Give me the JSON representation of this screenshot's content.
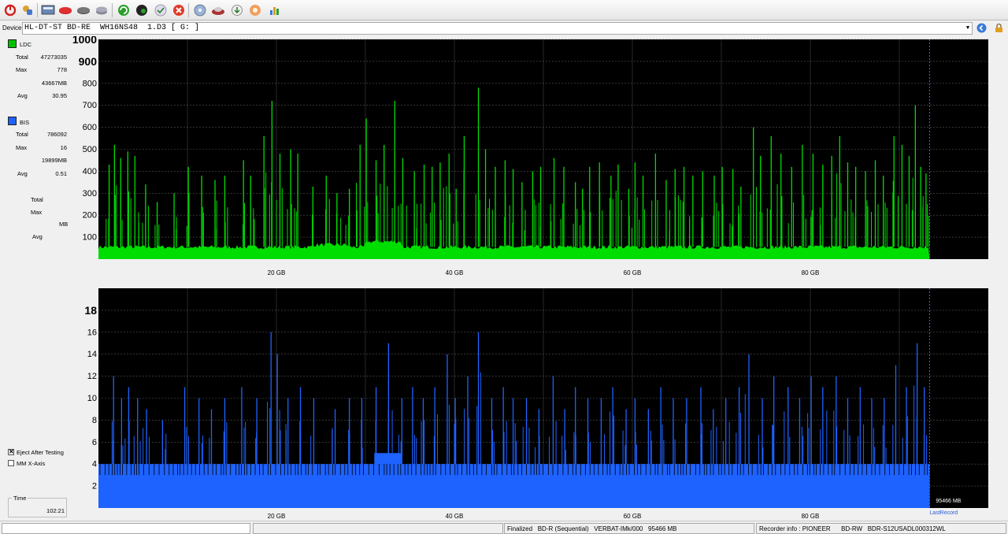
{
  "toolbar": {
    "icons": [
      "power-icon",
      "settings-icon",
      "info-icon",
      "disc-red-icon",
      "disc-erase-icon",
      "disc-copy-icon",
      "refresh-icon",
      "globe-icon",
      "check-icon",
      "stop-icon",
      "disc-blank-icon",
      "burn-icon",
      "save-icon",
      "test-icon",
      "chart-icon"
    ]
  },
  "device": {
    "label": "Device:",
    "value": "HL-DT-ST BD-RE  WH16NS48  1.D3 [ G: ]"
  },
  "stats": {
    "ldc": {
      "name": "LDC",
      "color": "#00cc00",
      "total_label": "Total",
      "total": "47273035",
      "max_label": "Max",
      "max": "778",
      "mb": "43667MB",
      "avg_label": "Avg",
      "avg": "30.95"
    },
    "bis": {
      "name": "BIS",
      "color": "#1e62ff",
      "total_label": "Total",
      "total": "786092",
      "max_label": "Max",
      "max": "16",
      "mb": "19899MB",
      "avg_label": "Avg",
      "avg": "0.51"
    },
    "third": {
      "total_label": "Total",
      "max_label": "Max",
      "mb_label": "MB",
      "avg_label": "Avg"
    }
  },
  "options": {
    "eject_label": "Eject After Testing",
    "eject_checked": true,
    "mm_label": "MM X-Axis",
    "mm_checked": false
  },
  "time": {
    "label": "Time",
    "value": "102:21"
  },
  "chart_data": [
    {
      "type": "bar",
      "series_name": "LDC",
      "color": "#00dd00",
      "xlabels": [
        "20 GB",
        "40 GB",
        "60 GB",
        "80 GB"
      ],
      "xticks_gb": [
        20,
        40,
        60,
        80
      ],
      "xlim_gb": [
        0,
        100
      ],
      "ylim": [
        0,
        1000
      ],
      "ytick_labels": [
        "100",
        "200",
        "300",
        "400",
        "500",
        "600",
        "700",
        "800",
        "900",
        "1000"
      ],
      "data_end_gb": 93.4,
      "baseline": 55,
      "max": 778,
      "peaks": [
        [
          1.2,
          430
        ],
        [
          1.8,
          520
        ],
        [
          2.5,
          460
        ],
        [
          3.3,
          490
        ],
        [
          4.1,
          470
        ],
        [
          5.3,
          340
        ],
        [
          6.6,
          260
        ],
        [
          8.5,
          300
        ],
        [
          10.1,
          420
        ],
        [
          11.6,
          380
        ],
        [
          13.1,
          360
        ],
        [
          14.2,
          380
        ],
        [
          16.3,
          450
        ],
        [
          17.1,
          380
        ],
        [
          18.6,
          560
        ],
        [
          19.5,
          720
        ],
        [
          20.4,
          480
        ],
        [
          21.6,
          500
        ],
        [
          22.4,
          480
        ],
        [
          24.1,
          330
        ],
        [
          25.6,
          380
        ],
        [
          26.8,
          300
        ],
        [
          28.2,
          320
        ],
        [
          29.4,
          520
        ],
        [
          30.1,
          640
        ],
        [
          31.2,
          450
        ],
        [
          32.1,
          520
        ],
        [
          33.3,
          720
        ],
        [
          34.2,
          460
        ],
        [
          35.5,
          400
        ],
        [
          36.6,
          430
        ],
        [
          37.5,
          420
        ],
        [
          38.4,
          440
        ],
        [
          39.4,
          480
        ],
        [
          40.2,
          320
        ],
        [
          41.1,
          560
        ],
        [
          42.7,
          780
        ],
        [
          43.5,
          500
        ],
        [
          44.6,
          420
        ],
        [
          45.7,
          450
        ],
        [
          46.6,
          410
        ],
        [
          47.6,
          350
        ],
        [
          48.8,
          400
        ],
        [
          49.7,
          420
        ],
        [
          51.2,
          460
        ],
        [
          52.3,
          420
        ],
        [
          53.6,
          350
        ],
        [
          54.4,
          320
        ],
        [
          55.2,
          420
        ],
        [
          56.3,
          440
        ],
        [
          57.6,
          380
        ],
        [
          58.4,
          430
        ],
        [
          59.6,
          320
        ],
        [
          60.3,
          440
        ],
        [
          61.2,
          380
        ],
        [
          62.6,
          480
        ],
        [
          63.8,
          360
        ],
        [
          64.8,
          410
        ],
        [
          65.8,
          420
        ],
        [
          66.8,
          380
        ],
        [
          67.9,
          400
        ],
        [
          69.2,
          380
        ],
        [
          70.1,
          420
        ],
        [
          71.3,
          410
        ],
        [
          72.2,
          330
        ],
        [
          73.6,
          600
        ],
        [
          74.4,
          470
        ],
        [
          75.6,
          560
        ],
        [
          76.7,
          480
        ],
        [
          77.9,
          420
        ],
        [
          79.1,
          520
        ],
        [
          80.3,
          480
        ],
        [
          81.4,
          430
        ],
        [
          82.4,
          470
        ],
        [
          83.3,
          560
        ],
        [
          84.2,
          440
        ],
        [
          85.1,
          420
        ],
        [
          86.2,
          400
        ],
        [
          87.3,
          450
        ],
        [
          88.2,
          380
        ],
        [
          89.4,
          560
        ],
        [
          90.3,
          520
        ],
        [
          91.1,
          470
        ],
        [
          91.8,
          700
        ],
        [
          92.4,
          420
        ],
        [
          93.0,
          390
        ]
      ]
    },
    {
      "type": "bar",
      "series_name": "BIS",
      "color": "#1e62ff",
      "xlabels": [
        "20 GB",
        "40 GB",
        "60 GB",
        "80 GB"
      ],
      "xticks_gb": [
        20,
        40,
        60,
        80
      ],
      "xlim_gb": [
        0,
        100
      ],
      "ylim": [
        0,
        20
      ],
      "ytick_labels": [
        "2",
        "4",
        "6",
        "8",
        "10",
        "12",
        "14",
        "16",
        "18"
      ],
      "data_end_gb": 93.4,
      "baseline": 4,
      "max": 16,
      "peaks": [
        [
          1.7,
          12
        ],
        [
          2.6,
          10
        ],
        [
          3.4,
          11
        ],
        [
          4.4,
          10
        ],
        [
          5.4,
          9
        ],
        [
          7.2,
          8
        ],
        [
          9.7,
          11
        ],
        [
          11.3,
          10
        ],
        [
          12.7,
          9
        ],
        [
          14.2,
          10
        ],
        [
          16.1,
          11
        ],
        [
          17.8,
          10
        ],
        [
          19.4,
          16
        ],
        [
          20.1,
          14
        ],
        [
          21.3,
          10
        ],
        [
          22.7,
          11
        ],
        [
          24.2,
          10
        ],
        [
          26.6,
          9
        ],
        [
          28.2,
          10
        ],
        [
          29.6,
          10
        ],
        [
          31.2,
          11
        ],
        [
          32.6,
          15
        ],
        [
          34.1,
          10
        ],
        [
          35.3,
          11
        ],
        [
          36.5,
          10
        ],
        [
          37.8,
          11
        ],
        [
          39.2,
          14
        ],
        [
          40.1,
          10
        ],
        [
          41.5,
          12
        ],
        [
          42.7,
          16
        ],
        [
          44.2,
          10
        ],
        [
          45.5,
          11
        ],
        [
          46.6,
          10
        ],
        [
          48.1,
          10
        ],
        [
          49.5,
          9
        ],
        [
          51.1,
          12
        ],
        [
          52.4,
          9
        ],
        [
          53.6,
          11
        ],
        [
          55.0,
          10
        ],
        [
          56.5,
          10
        ],
        [
          57.8,
          11
        ],
        [
          59.3,
          9
        ],
        [
          60.3,
          10
        ],
        [
          61.8,
          9
        ],
        [
          63.2,
          11
        ],
        [
          64.6,
          10
        ],
        [
          66.1,
          10
        ],
        [
          67.7,
          11
        ],
        [
          69.1,
          9
        ],
        [
          70.5,
          10
        ],
        [
          72.0,
          11
        ],
        [
          73.1,
          14
        ],
        [
          74.6,
          10
        ],
        [
          75.9,
          12
        ],
        [
          77.5,
          11
        ],
        [
          78.8,
          10
        ],
        [
          80.1,
          12
        ],
        [
          81.4,
          11
        ],
        [
          82.9,
          12
        ],
        [
          84.2,
          10
        ],
        [
          85.6,
          11
        ],
        [
          86.9,
          10
        ],
        [
          88.3,
          10
        ],
        [
          89.6,
          13
        ],
        [
          90.8,
          11
        ],
        [
          92.0,
          15
        ],
        [
          92.8,
          11
        ]
      ],
      "end_marker": "95466 MB",
      "end_label": "LastRecord"
    }
  ],
  "statusbar": {
    "finalized": "Finalized",
    "disc_type": "BD-R (Sequential)",
    "media": "VERBAT-IMk/000",
    "capacity": "95466 MB",
    "recorder_label": "Recorder info :",
    "recorder_vendor": "PIONEER",
    "recorder_type": "BD-RW",
    "recorder_model": "BDR-S12USADL000312WL"
  }
}
